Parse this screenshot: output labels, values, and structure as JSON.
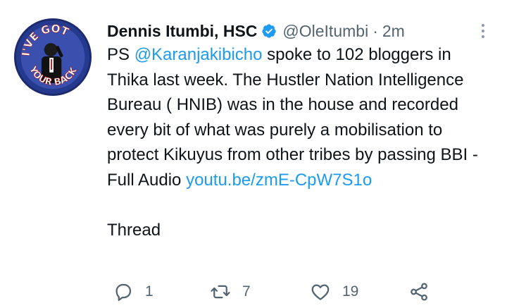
{
  "tweet": {
    "author": {
      "name": "Dennis Itumbi, HSC",
      "handle": "@OleItumbi",
      "time": "2m",
      "verified_color": "#1d9bf0",
      "avatar_text_top": "I'VE GOT",
      "avatar_text_bottom": "YOUR BACK"
    },
    "body": {
      "prefix": "PS ",
      "mention": "@Karanjakibicho",
      "text": " spoke to 102 bloggers in Thika last week. The Hustler Nation Intelligence Bureau ( HNIB) was in the house and recorded every bit of what was purely a mobilisation to protect Kikuyus from other tribes by passing BBI - Full Audio ",
      "link": "youtu.be/zmE-CpW7S1o",
      "thread_label": "Thread"
    },
    "actions": {
      "replies": "1",
      "retweets": "7",
      "likes": "19"
    },
    "colors": {
      "link": "#1d9bf0",
      "secondary_text": "#536471",
      "primary_text": "#0f1419"
    }
  }
}
